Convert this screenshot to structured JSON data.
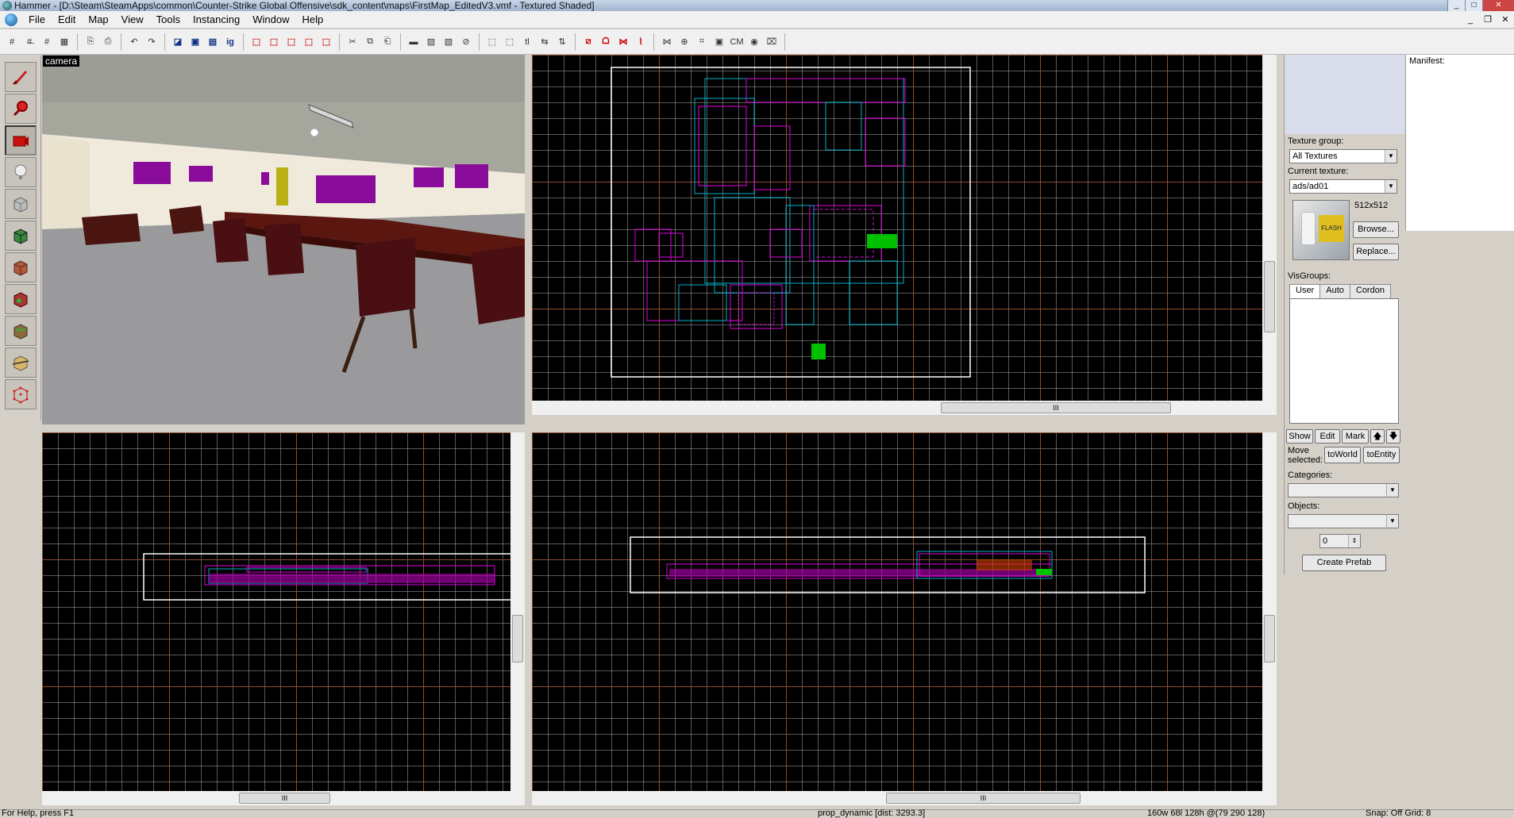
{
  "window": {
    "title": "Hammer - [D:\\Steam\\SteamApps\\common\\Counter-Strike Global Offensive\\sdk_content\\maps\\FirstMap_EditedV3.vmf - Textured Shaded]",
    "minimize": "_",
    "maximize": "□",
    "close": "✕"
  },
  "menu": {
    "items": [
      "File",
      "Edit",
      "Map",
      "View",
      "Tools",
      "Instancing",
      "Window",
      "Help"
    ],
    "mdi_min": "_",
    "mdi_restore": "❐",
    "mdi_close": "✕"
  },
  "toolbar": {
    "groups": [
      [
        "#",
        "#̶",
        "#",
        "▦"
      ],
      [
        "⎘",
        "⎙"
      ],
      [
        "↶",
        "↷"
      ],
      [
        "◪",
        "▣",
        "▤",
        "ig"
      ],
      [
        "⬚",
        "⬚",
        "⬚",
        "⬚",
        "⬚"
      ],
      [
        "✂",
        "⧉",
        "⎗"
      ],
      [
        "▬",
        "▨",
        "▧",
        "⊘"
      ],
      [
        "⬚",
        "⬚",
        "tl",
        "⇆",
        "⇅"
      ],
      [
        "⧄",
        "ᗝ",
        "⋈",
        "⌇"
      ],
      [
        "⋈",
        "⊕",
        "⌗",
        "▣",
        "CM",
        "◉",
        "⌧"
      ]
    ]
  },
  "palette": {
    "tools": [
      "selection-tool",
      "magnify-tool",
      "camera-tool",
      "entity-tool",
      "block-tool",
      "texture-application-tool",
      "apply-current-texture-tool",
      "decal-tool",
      "overlay-tool",
      "clipping-tool",
      "vertex-tool"
    ]
  },
  "viewports": {
    "camera_label": "camera",
    "scroll_grip": "III"
  },
  "texture_panel": {
    "texture_group_label": "Texture group:",
    "texture_group_value": "All Textures",
    "current_texture_label": "Current texture:",
    "current_texture_value": "ads/ad01",
    "texture_size": "512x512",
    "browse_label": "Browse...",
    "replace_label": "Replace...",
    "preview_text": "FLASH"
  },
  "visgroups": {
    "label": "VisGroups:",
    "tabs": [
      "User",
      "Auto",
      "Cordon"
    ],
    "show_label": "Show",
    "edit_label": "Edit",
    "mark_label": "Mark",
    "up_label": "🡅",
    "down_label": "🡇",
    "move_selected_label_1": "Move",
    "move_selected_label_2": "selected:",
    "to_world_label": "toWorld",
    "to_entity_label": "toEntity"
  },
  "prefab": {
    "categories_label": "Categories:",
    "objects_label": "Objects:",
    "count_value": "0",
    "create_prefab_label": "Create Prefab"
  },
  "manifest": {
    "label": "Manifest:"
  },
  "statusbar": {
    "help": "For Help, press F1",
    "selection": "prop_dynamic  [dist: 3293.3]",
    "size": "160w 68l 128h @(79 290 128)",
    "snap": "Snap: Off Grid: 8"
  },
  "colors": {
    "brush_wire": "#e000e0",
    "visgroup_wire": "#00b0c8",
    "grid_major": "#8a4a28",
    "bounds": "#ffffff",
    "highlight": "#00c000"
  }
}
